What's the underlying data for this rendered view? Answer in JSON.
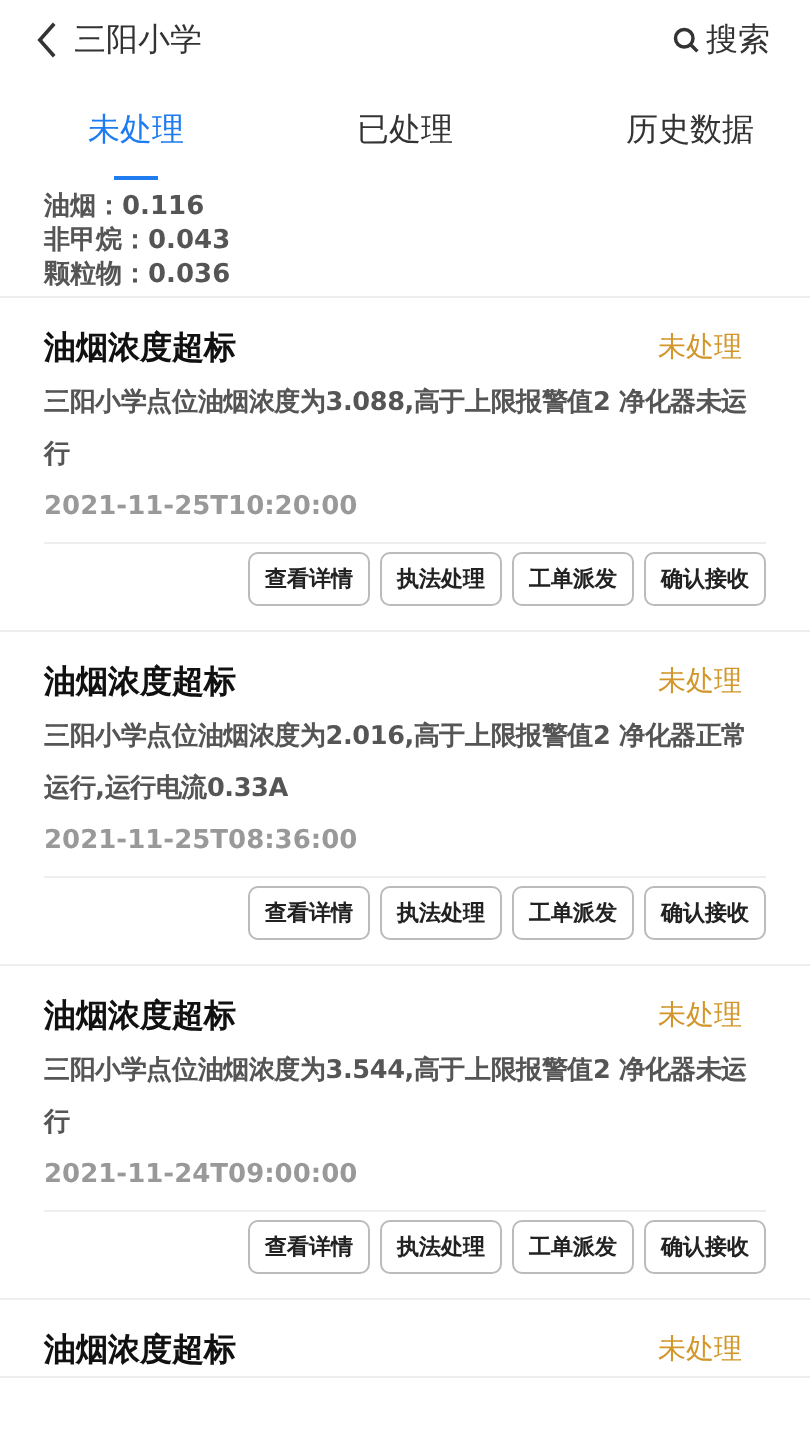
{
  "header": {
    "title": "三阳小学",
    "search_label": "搜索"
  },
  "tabs": [
    {
      "label": "未处理",
      "selected": true
    },
    {
      "label": "已处理",
      "selected": false
    },
    {
      "label": "历史数据",
      "selected": false
    }
  ],
  "summary": [
    "油烟：0.116",
    "非甲烷：0.043",
    "颗粒物：0.036"
  ],
  "alerts": [
    {
      "title": "油烟浓度超标",
      "status": "未处理",
      "description": "三阳小学点位油烟浓度为3.088,高于上限报警值2 净化器未运行",
      "time": "2021-11-25T10:20:00",
      "actions": [
        "查看详情",
        "执法处理",
        "工单派发",
        "确认接收"
      ]
    },
    {
      "title": "油烟浓度超标",
      "status": "未处理",
      "description": "三阳小学点位油烟浓度为2.016,高于上限报警值2 净化器正常运行,运行电流0.33A",
      "time": "2021-11-25T08:36:00",
      "actions": [
        "查看详情",
        "执法处理",
        "工单派发",
        "确认接收"
      ]
    },
    {
      "title": "油烟浓度超标",
      "status": "未处理",
      "description": "三阳小学点位油烟浓度为3.544,高于上限报警值2 净化器未运行",
      "time": "2021-11-24T09:00:00",
      "actions": [
        "查看详情",
        "执法处理",
        "工单派发",
        "确认接收"
      ]
    },
    {
      "title": "油烟浓度超标",
      "status": "未处理"
    }
  ]
}
